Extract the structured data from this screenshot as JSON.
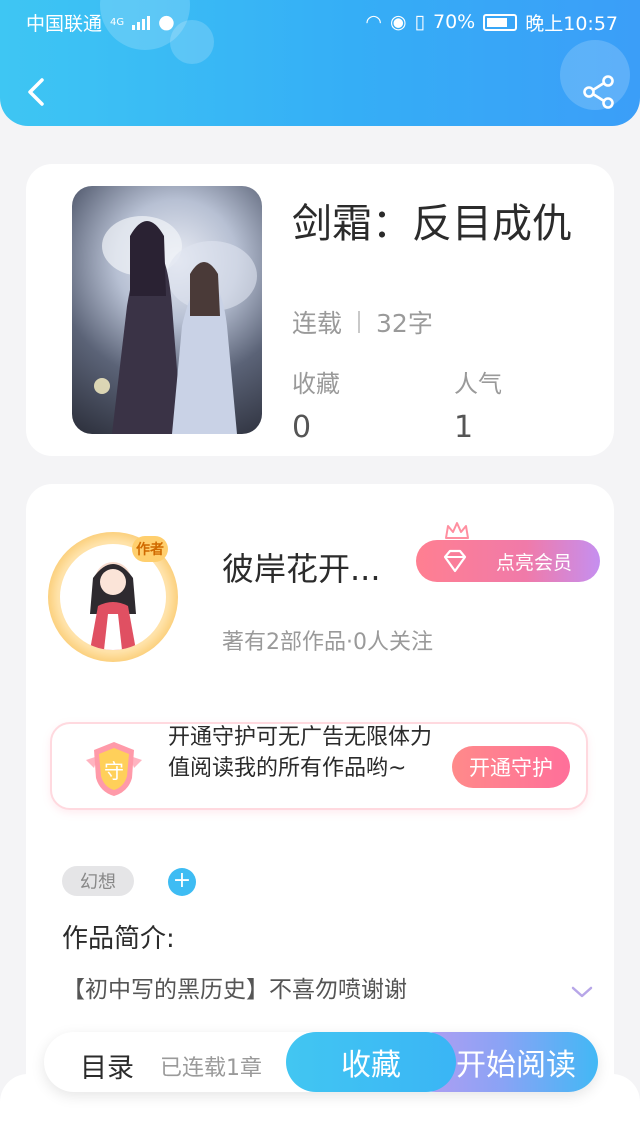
{
  "status_bar": {
    "carrier": "中国联通",
    "network": "4G",
    "battery": "70%",
    "time": "晚上10:57"
  },
  "header": {
    "back_icon": "chevron-left-icon",
    "share_icon": "share-icon"
  },
  "book": {
    "title": "剑霜：反目成仇",
    "status": "连载",
    "words": "32字",
    "favorites_label": "收藏",
    "favorites_value": "0",
    "popularity_label": "人气",
    "popularity_value": "1"
  },
  "author": {
    "badge": "作者",
    "name": "彼岸花开...",
    "vip_label": "点亮会员",
    "stats": "著有2部作品·0人关注"
  },
  "guard": {
    "text": "开通守护可无广告无限体力值阅读我的所有作品哟~",
    "shield_char": "守",
    "button": "开通守护"
  },
  "tags": [
    "幻想"
  ],
  "intro": {
    "label": "作品简介:",
    "text": "【初中写的黑历史】不喜勿喷谢谢"
  },
  "bottom_bar": {
    "toc": "目录",
    "chapters": "已连载1章",
    "favorite": "收藏",
    "start_reading": "开始阅读"
  },
  "colors": {
    "header": "#38b6f5",
    "accent_pink": "#ff7f91",
    "accent_purple": "#c58ff0"
  }
}
